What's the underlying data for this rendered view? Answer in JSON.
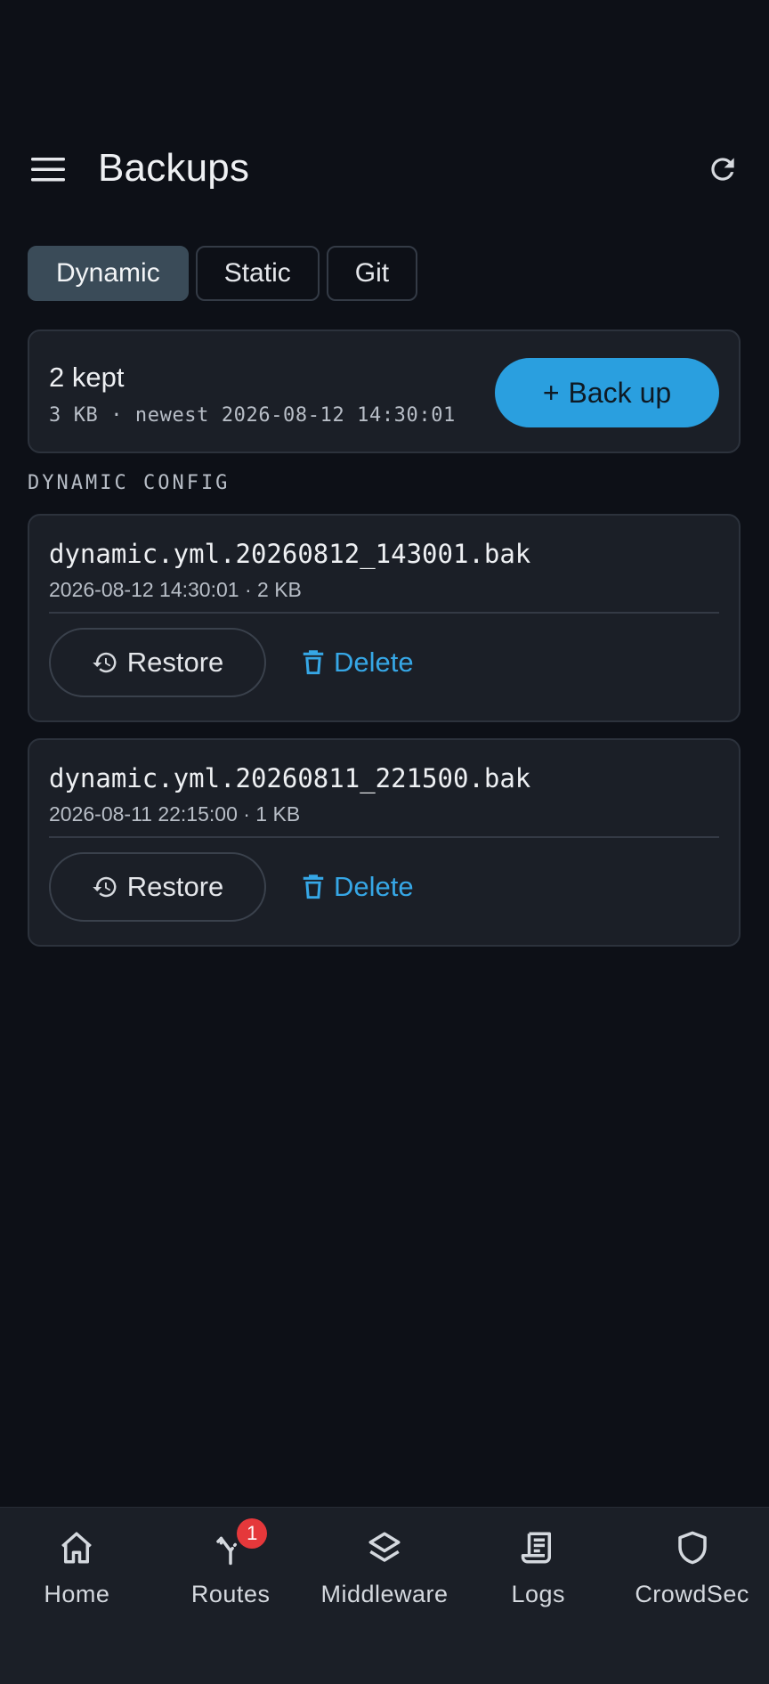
{
  "header": {
    "title": "Backups"
  },
  "tabs": [
    {
      "label": "Dynamic",
      "active": true
    },
    {
      "label": "Static",
      "active": false
    },
    {
      "label": "Git",
      "active": false
    }
  ],
  "summary": {
    "count": "2 kept",
    "meta": "3 KB · newest 2026-08-12 14:30:01",
    "backup_button": "Back up",
    "backup_button_icon": "+"
  },
  "section_label": "DYNAMIC CONFIG",
  "backups": [
    {
      "file": "dynamic.yml.20260812_143001.bak",
      "meta": "2026-08-12 14:30:01 · 2 KB",
      "restore_label": "Restore",
      "delete_label": "Delete"
    },
    {
      "file": "dynamic.yml.20260811_221500.bak",
      "meta": "2026-08-11 22:15:00 · 1 KB",
      "restore_label": "Restore",
      "delete_label": "Delete"
    }
  ],
  "nav": [
    {
      "label": "Home",
      "icon": "home-icon"
    },
    {
      "label": "Routes",
      "icon": "routes-icon",
      "badge": "1"
    },
    {
      "label": "Middleware",
      "icon": "layers-icon"
    },
    {
      "label": "Logs",
      "icon": "receipt-icon"
    },
    {
      "label": "CrowdSec",
      "icon": "shield-icon"
    }
  ],
  "colors": {
    "background": "#0d1017",
    "card": "#1b1f27",
    "accent": "#2a9fdf",
    "active_tab": "#3a4b58",
    "badge": "#e5383b"
  }
}
